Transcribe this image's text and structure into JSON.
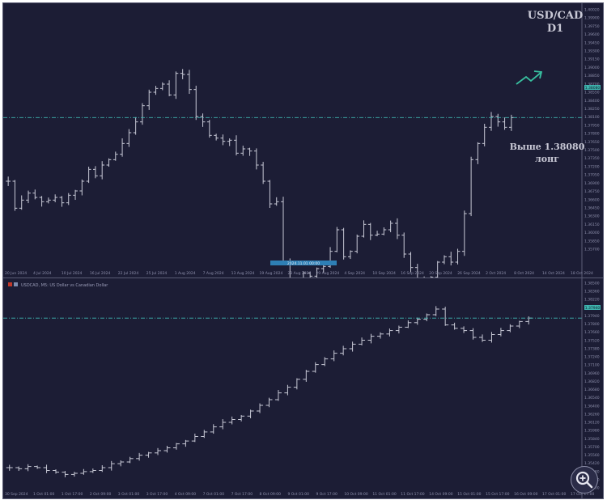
{
  "colors": {
    "bg": "#1c1d35",
    "bar": "#c8c9d6",
    "axis_text": "#8f91ad",
    "level_line": "#3fb5b0",
    "arrow": "#38c0a0",
    "price_badge": "#3fb5b0"
  },
  "top_chart": {
    "symbol": "USD/CAD",
    "timeframe": "D1",
    "annotation_line1": "Выше 1.38080",
    "annotation_line2": "лонг",
    "current_price": "1.38080",
    "y_ticks": [
      "1.40020",
      "1.39900",
      "1.39750",
      "1.39600",
      "1.39450",
      "1.39300",
      "1.39150",
      "1.39000",
      "1.38850",
      "1.38700",
      "1.38550",
      "1.38400",
      "1.38250",
      "1.38100",
      "1.37950",
      "1.37800",
      "1.37650",
      "1.37500",
      "1.37350",
      "1.37200",
      "1.37050",
      "1.36900",
      "1.36750",
      "1.36600",
      "1.36450",
      "1.36300",
      "1.36150",
      "1.36000",
      "1.35850",
      "1.35700"
    ],
    "x_ticks": [
      "20 Jun 2024",
      "4 Jul 2024",
      "10 Jul 2024",
      "16 Jul 2024",
      "22 Jul 2024",
      "25 Jul 2024",
      "1 Aug 2024",
      "7 Aug 2024",
      "13 Aug 2024",
      "19 Aug 2024",
      "23 Aug 2024",
      "29 Aug 2024",
      "4 Sep 2024",
      "10 Sep 2024",
      "16 Sep 2024",
      "20 Sep 2024",
      "26 Sep 2024",
      "2 Oct 2024",
      "8 Oct 2024",
      "14 Oct 2024",
      "18 Oct 2024"
    ],
    "x_selected": "2024.11.01 00:00"
  },
  "bottom_chart": {
    "info": "USDCAD, M5: US Dollar vs Canadian Dollar",
    "current_price": "1.37940",
    "y_ticks": [
      "1.38500",
      "1.38360",
      "1.38220",
      "1.38080",
      "1.37940",
      "1.37800",
      "1.37660",
      "1.37520",
      "1.37380",
      "1.37240",
      "1.37100",
      "1.36960",
      "1.36820",
      "1.36680",
      "1.36540",
      "1.36400",
      "1.36260",
      "1.36120",
      "1.35980",
      "1.35840",
      "1.35700",
      "1.35560",
      "1.35420",
      "1.35280",
      "1.35140",
      "1.35000"
    ],
    "x_ticks": [
      "30 Sep 2024",
      "1 Oct 01:00",
      "1 Oct 17:00",
      "2 Oct 09:00",
      "3 Oct 01:00",
      "3 Oct 17:00",
      "4 Oct 09:00",
      "7 Oct 01:00",
      "7 Oct 17:00",
      "8 Oct 09:00",
      "9 Oct 01:00",
      "9 Oct 17:00",
      "10 Oct 09:00",
      "11 Oct 01:00",
      "11 Oct 17:00",
      "14 Oct 09:00",
      "15 Oct 01:00",
      "15 Oct 17:00",
      "16 Oct 09:00",
      "17 Oct 01:00",
      "17 Oct 17:00"
    ]
  },
  "zoom_icon": "magnifier-plus-icon",
  "chart_data": [
    {
      "type": "ohlc",
      "title": "USD/CAD D1",
      "ylim": [
        1.357,
        1.4002
      ],
      "level": 1.3808,
      "grid": false,
      "series": [
        {
          "values": [
            1.369,
            1.364,
            1.3655,
            1.3668,
            1.366,
            1.3652,
            1.3655,
            1.366,
            1.365,
            1.3664,
            1.3672,
            1.369,
            1.3712,
            1.37,
            1.372,
            1.373,
            1.374,
            1.376,
            1.378,
            1.38,
            1.383,
            1.3855,
            1.3862,
            1.387,
            1.385,
            1.389,
            1.3888,
            1.386,
            1.381,
            1.38,
            1.3775,
            1.377,
            1.3764,
            1.3766,
            1.3742,
            1.375,
            1.3746,
            1.372,
            1.369,
            1.3648,
            1.3652,
            1.354,
            1.35,
            1.3502,
            1.352,
            1.3514,
            1.3528,
            1.3532,
            1.356,
            1.36,
            1.355,
            1.356,
            1.3588,
            1.361,
            1.359,
            1.3592,
            1.36,
            1.3612,
            1.359,
            1.3555,
            1.353,
            1.348,
            1.351,
            1.3512,
            1.354,
            1.355,
            1.354,
            1.356,
            1.363,
            1.373,
            1.376,
            1.379,
            1.381,
            1.38,
            1.379,
            1.3808
          ]
        }
      ]
    },
    {
      "type": "ohlc",
      "title": "USDCAD, M5",
      "ylim": [
        1.35,
        1.385
      ],
      "level": 1.3794,
      "grid": false,
      "series": [
        {
          "values": [
            1.353,
            1.3528,
            1.3532,
            1.353,
            1.3525,
            1.3522,
            1.3518,
            1.352,
            1.3523,
            1.3525,
            1.353,
            1.3537,
            1.354,
            1.3546,
            1.3552,
            1.3556,
            1.356,
            1.3565,
            1.3572,
            1.3577,
            1.3585,
            1.3593,
            1.3602,
            1.361,
            1.3615,
            1.3621,
            1.363,
            1.364,
            1.365,
            1.3662,
            1.3672,
            1.3686,
            1.37,
            1.3712,
            1.3722,
            1.3732,
            1.374,
            1.3748,
            1.3755,
            1.3762,
            1.3766,
            1.3772,
            1.3778,
            1.3786,
            1.3792,
            1.38,
            1.381,
            1.3782,
            1.3776,
            1.3772,
            1.376,
            1.3755,
            1.3765,
            1.3772,
            1.378,
            1.3788,
            1.3794
          ]
        }
      ]
    }
  ]
}
